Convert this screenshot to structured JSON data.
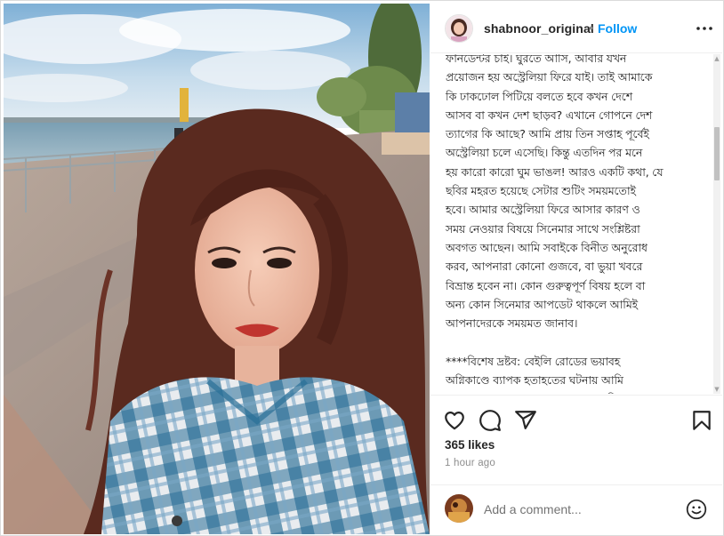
{
  "post": {
    "username": "shabnoor_original",
    "separator": "•",
    "follow_label": "Follow",
    "caption": "ফানডেন্টর চাই। ঘুরতে আসি, আবার যখন\nপ্রয়োজন হয় অস্ট্রেলিয়া ফিরে যাই। তাই আমাকে\nকি ঢাকঢোল পিটিয়ে বলতে হবে কখন দেশে\nআসব বা কখন দেশ ছাড়ব? এখানে গোপনে দেশ\nত্যাগের কি আছে? আমি প্রায় তিন সপ্তাহ পূর্বেই\nঅস্ট্রেলিয়া চলে এসেছি। কিন্তু এতদিন পর মনে\nহয় কারো কারো ঘুম ভাঙল! আরও একটি কথা, যে\nছবির মহরত হয়েছে সেটার শুটিং সময়মতোই\nহবে। আমার অস্ট্রেলিয়া ফিরে আসার কারণ ও\nসময় নেওয়ার বিষয়ে সিনেমার সাথে সংশ্লিষ্টরা\nঅবগত আছেন। আমি সবাইকে বিনীত অনুরোধ\nকরব, আপনারা কোনো গুজবে, বা ভুয়া খবরে\nবিভ্রান্ত হবেন না। কোন গুরুত্বপূর্ণ বিষয় হলে বা\nঅন্য কোন সিনেমার আপডেট থাকলে আমিই\nআপনাদেরকে সময়মত জানাব।\n\n****বিশেষ দ্রষ্টব: বেইলি রোডের ভয়াবহ\nঅগ্নিকাণ্ডে ব্যাপক হতাহতের ঘটনায় আমি\nশোকাহত, বাকরুদ্ধ। আল্লাহ্‌ পাক যেন নিহতদের\nপরিবারের সবাইকে এই শোক সইবার শক্তি দান\nকরেন, এবং আহত ও ক্ষতিগ্রস্তদের ধৈর্য্য দান\nকরেন। 🙏",
    "likes": "365 likes",
    "time": "1 hour ago"
  },
  "comment": {
    "placeholder": "Add a comment..."
  },
  "icons": {
    "more": "more-options-icon",
    "like": "heart-icon",
    "comment": "comment-icon",
    "share": "share-icon",
    "save": "bookmark-icon",
    "emoji": "emoji-icon"
  },
  "colors": {
    "accent": "#0095f6",
    "text": "#262626",
    "muted": "#8e8e8e"
  }
}
